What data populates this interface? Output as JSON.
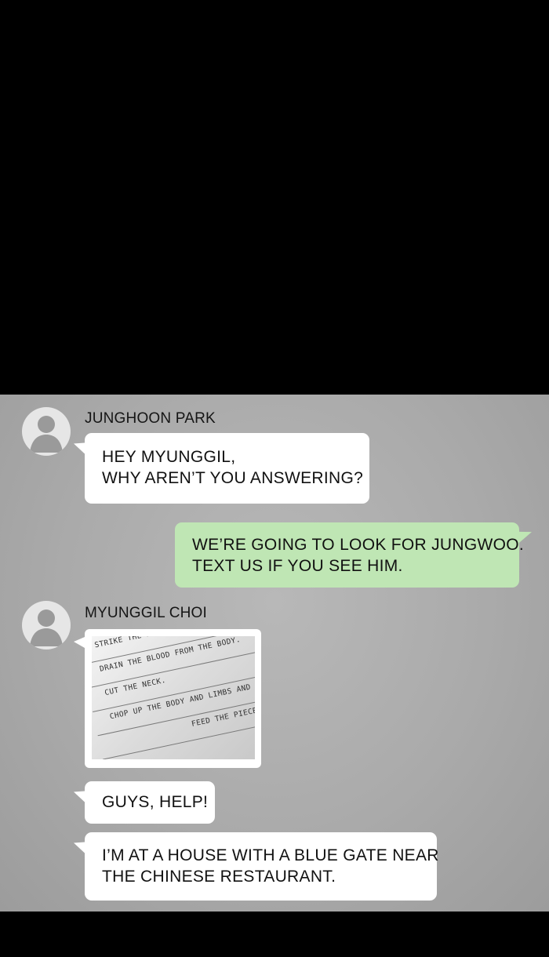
{
  "messages": {
    "junghoon": {
      "sender": "JUNGHOON PARK",
      "lines": [
        "HEY MYUNGGIL,",
        "WHY AREN’T YOU ANSWERING?"
      ]
    },
    "outgoing": {
      "lines": [
        "WE’RE GOING TO LOOK FOR JUNGWOO.",
        "TEXT US IF YOU SEE HIM."
      ]
    },
    "myunggil": {
      "sender": "MYUNGGIL CHOI",
      "image_lines": [
        "STRIKE THE HEAD WITH A HAMMER FOR T",
        "DRAIN THE BLOOD FROM THE BODY.",
        "CUT THE NECK.",
        "CHOP UP THE BODY AND LIMBS AND BOIL",
        "FEED THE PIECES TO"
      ],
      "help": "GUYS, HELP!",
      "location_lines": [
        "I’M AT A HOUSE WITH A BLUE GATE NEAR",
        "THE CHINESE RESTAURANT."
      ]
    }
  },
  "icons": {
    "avatar": "default-person-icon"
  },
  "colors": {
    "outgoing_bubble": "#bfe6b4",
    "incoming_bubble": "#ffffff",
    "background": "#aaaaaa"
  }
}
